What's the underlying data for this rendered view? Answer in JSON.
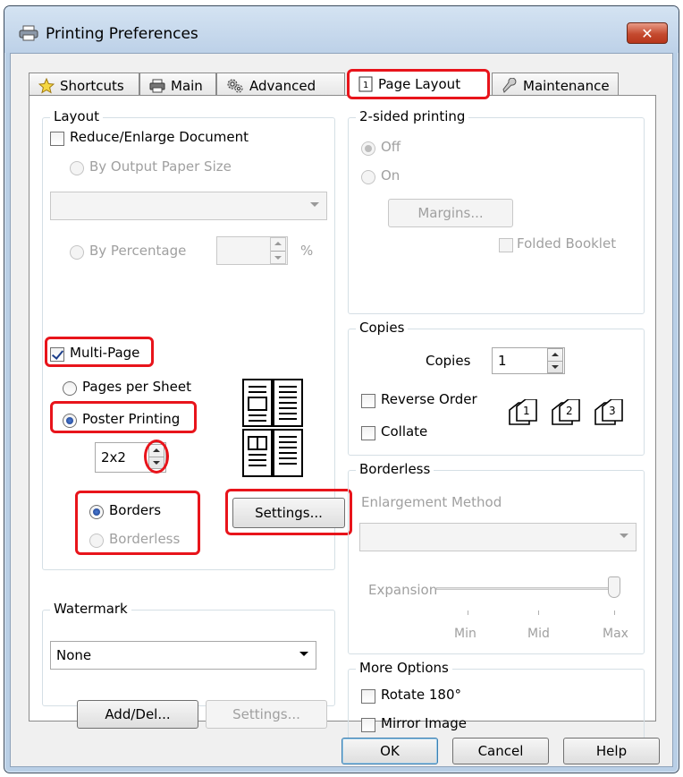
{
  "window": {
    "title": "Printing Preferences",
    "close_label": "✕"
  },
  "tabs": [
    {
      "label": "Shortcuts",
      "icon": "star-icon"
    },
    {
      "label": "Main",
      "icon": "printer-icon"
    },
    {
      "label": "Advanced",
      "icon": "gears-icon"
    },
    {
      "label": "Page Layout",
      "icon": "page-icon",
      "active": true
    },
    {
      "label": "Maintenance",
      "icon": "wrench-icon"
    }
  ],
  "layout": {
    "group_label": "Layout",
    "reduce_enlarge": {
      "label": "Reduce/Enlarge Document",
      "checked": false
    },
    "by_output_paper_size": "By Output Paper Size",
    "paper_size_value": "",
    "by_percentage": "By Percentage",
    "percentage_value": "",
    "percent_unit": "%",
    "multi_page": {
      "label": "Multi-Page",
      "checked": true
    },
    "pages_per_sheet": "Pages per Sheet",
    "poster_printing": "Poster Printing",
    "poster_size": "2x2",
    "borders": "Borders",
    "borderless": "Borderless",
    "settings_button": "Settings..."
  },
  "two_sided": {
    "group_label": "2-sided printing",
    "off": "Off",
    "on": "On",
    "margins_button": "Margins...",
    "folded_booklet": "Folded Booklet"
  },
  "copies": {
    "group_label": "Copies",
    "copies_label": "Copies",
    "copies_value": "1",
    "reverse_order": "Reverse Order",
    "collate": "Collate",
    "collate_icon_digits": [
      "1",
      "2",
      "3"
    ]
  },
  "borderless": {
    "group_label": "Borderless",
    "enlargement_method": "Enlargement Method",
    "expansion": "Expansion",
    "tick_min": "Min",
    "tick_mid": "Mid",
    "tick_max": "Max",
    "expansion_level": "Max"
  },
  "watermark": {
    "group_label": "Watermark",
    "value": "None",
    "add_del_button": "Add/Del...",
    "settings_button": "Settings..."
  },
  "more_options": {
    "group_label": "More Options",
    "rotate": "Rotate 180°",
    "mirror": "Mirror Image"
  },
  "footer": {
    "ok": "OK",
    "cancel": "Cancel",
    "help": "Help"
  },
  "colors": {
    "highlight": "#e8141b",
    "title_bar": "#bdd1e8",
    "client_bg": "#f0f0f0"
  }
}
